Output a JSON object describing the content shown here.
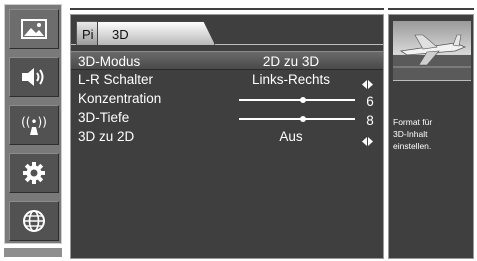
{
  "sidebar": {
    "items": [
      {
        "icon": "picture-icon"
      },
      {
        "icon": "speaker-icon"
      },
      {
        "icon": "wireless-signal-icon"
      },
      {
        "icon": "gear-icon"
      },
      {
        "icon": "globe-icon"
      }
    ]
  },
  "tabs": {
    "back_label": "Pi",
    "active_label": "3D"
  },
  "menu": {
    "mode_label": "3D-Modus",
    "mode_value": "2D zu 3D",
    "lr_label": "L-R Schalter",
    "lr_value": "Links-Rechts",
    "conc_label": "Konzentration",
    "conc_value": "6",
    "conc_level": 0.55,
    "depth_label": "3D-Tiefe",
    "depth_value": "8",
    "depth_level": 0.55,
    "to2d_label": "3D zu 2D",
    "to2d_value": "Aus"
  },
  "info": {
    "line1": "Format für",
    "line2": "3D-Inhalt",
    "line3": "einstellen."
  }
}
